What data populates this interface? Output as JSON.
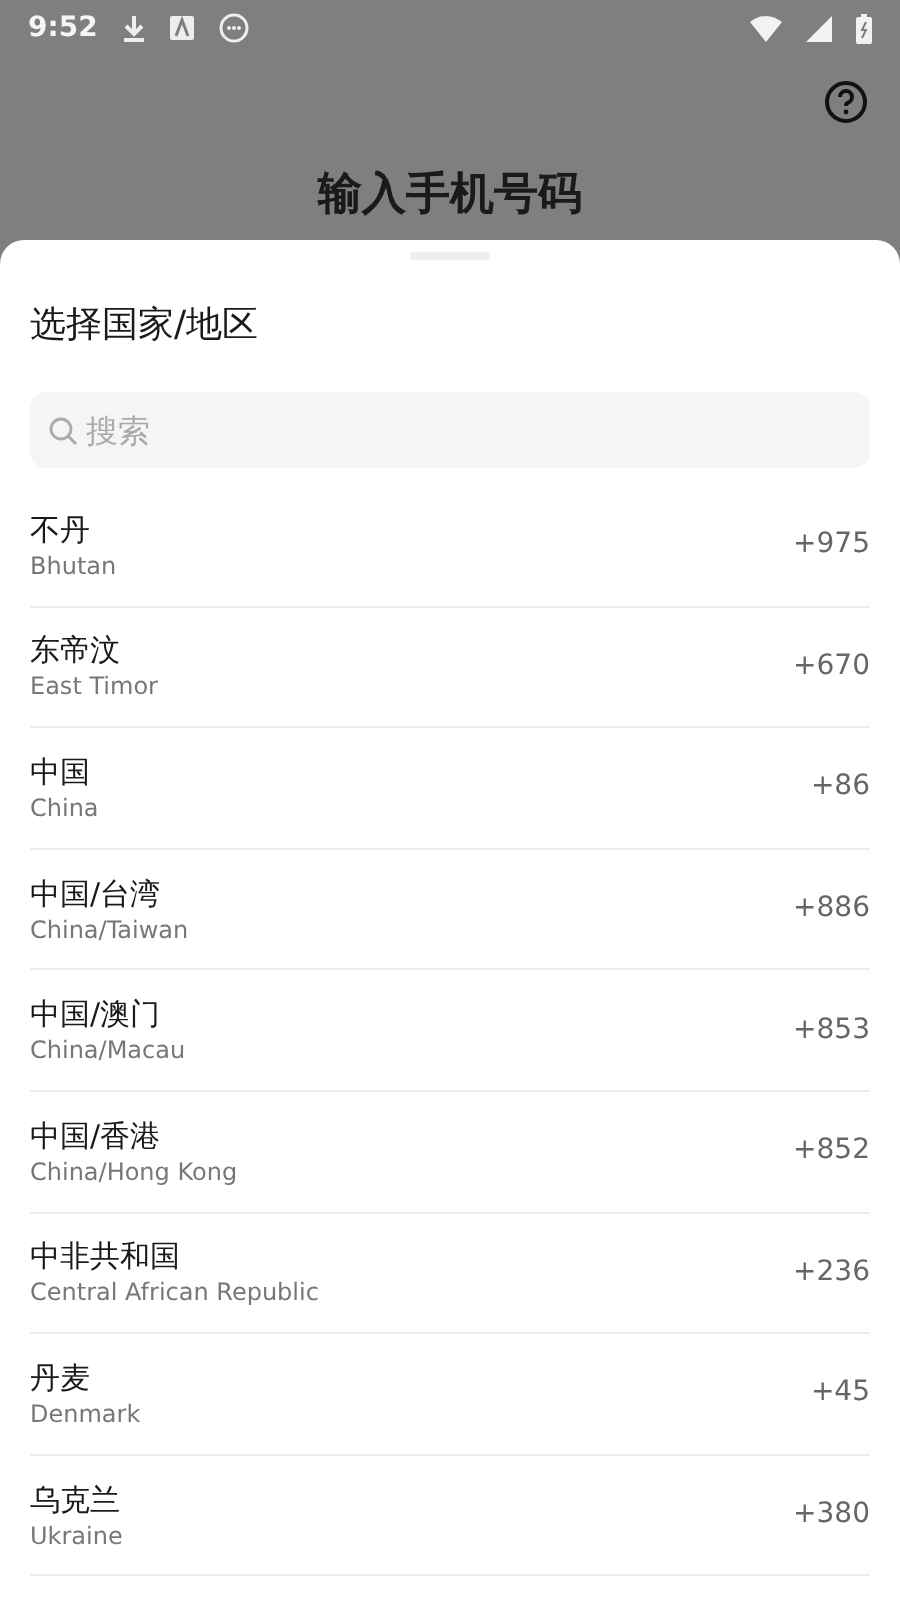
{
  "status_bar": {
    "time": "9:52"
  },
  "header": {
    "title": "输入手机号码"
  },
  "sheet": {
    "title": "选择国家/地区",
    "search": {
      "placeholder": "搜索"
    },
    "countries": [
      {
        "name": "不丹",
        "english": "Bhutan",
        "code": "+975"
      },
      {
        "name": "东帝汶",
        "english": "East Timor",
        "code": "+670"
      },
      {
        "name": "中国",
        "english": "China",
        "code": "+86"
      },
      {
        "name": "中国/台湾",
        "english": "China/Taiwan",
        "code": "+886"
      },
      {
        "name": "中国/澳门",
        "english": "China/Macau",
        "code": "+853"
      },
      {
        "name": "中国/香港",
        "english": "China/Hong Kong",
        "code": "+852"
      },
      {
        "name": "中非共和国",
        "english": "Central African Republic",
        "code": "+236"
      },
      {
        "name": "丹麦",
        "english": "Denmark",
        "code": "+45"
      },
      {
        "name": "乌克兰",
        "english": "Ukraine",
        "code": "+380"
      }
    ]
  }
}
